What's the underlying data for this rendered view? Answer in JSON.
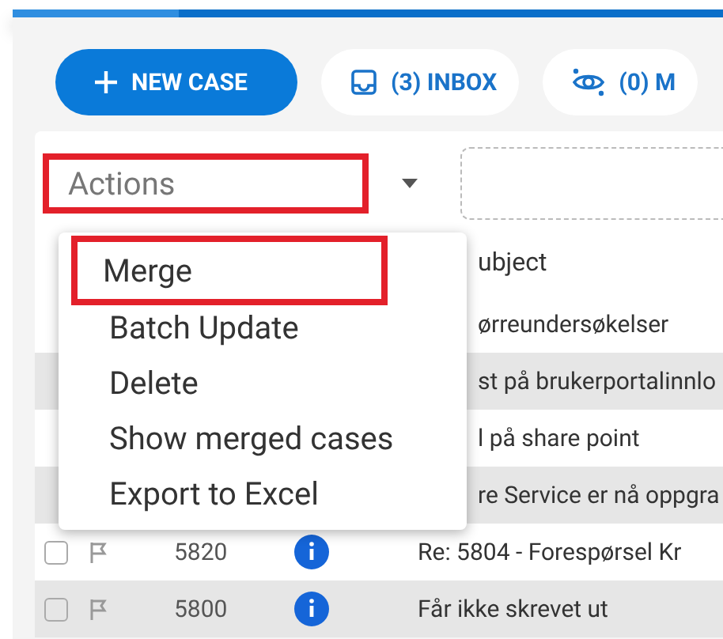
{
  "toolbar": {
    "buttons": [
      {
        "kind": "primary",
        "label": "NEW CASE"
      },
      {
        "kind": "secondary",
        "label": "(3) INBOX"
      },
      {
        "kind": "secondary",
        "label": "(0) M"
      }
    ]
  },
  "actions": {
    "placeholder": "Actions",
    "highlighted": true
  },
  "actions_menu": {
    "items": [
      {
        "label": "Merge",
        "highlighted": true
      },
      {
        "label": "Batch Update",
        "highlighted": false
      },
      {
        "label": "Delete",
        "highlighted": false
      },
      {
        "label": "Show merged cases",
        "highlighted": false
      },
      {
        "label": "Export to Excel",
        "highlighted": false
      }
    ]
  },
  "table": {
    "columns": [
      "ubject"
    ],
    "rows": [
      {
        "subject": "ørreundersøkelser"
      },
      {
        "subject": "st på brukerportalinnlo"
      },
      {
        "subject": "l på share point"
      },
      {
        "subject": "re Service er nå oppgra"
      },
      {
        "number": "5820",
        "checked": false,
        "subject": "Re: 5804 - Forespørsel Kr"
      },
      {
        "number": "5800",
        "checked": false,
        "subject": "Får ikke skrevet ut"
      }
    ]
  }
}
